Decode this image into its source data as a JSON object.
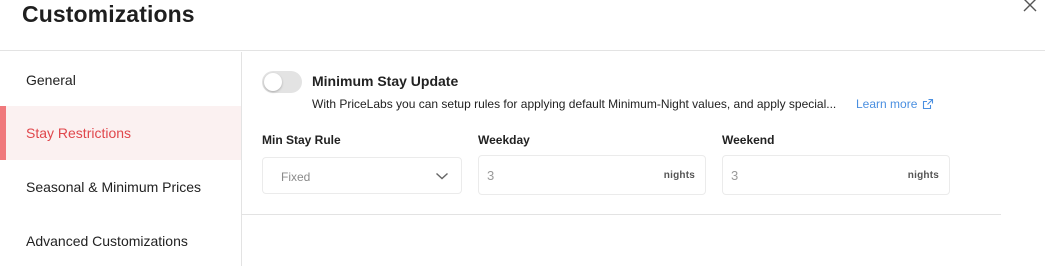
{
  "dialog": {
    "title": "Customizations",
    "close_icon": "close-icon"
  },
  "sidebar": {
    "items": [
      {
        "label": "General",
        "active": false
      },
      {
        "label": "Stay Restrictions",
        "active": true
      },
      {
        "label": "Seasonal & Minimum Prices",
        "active": false
      },
      {
        "label": "Advanced Customizations",
        "active": false
      }
    ]
  },
  "min_stay": {
    "toggle_on": false,
    "title": "Minimum Stay Update",
    "description": "With PriceLabs you can setup rules for applying default Minimum-Night values, and apply special...",
    "learn_more": "Learn more",
    "learn_more_icon": "external-link-icon"
  },
  "fields": {
    "rule_label": "Min Stay Rule",
    "rule_value": "Fixed",
    "weekday_label": "Weekday",
    "weekday_value": "3",
    "weekday_unit": "nights",
    "weekend_label": "Weekend",
    "weekend_value": "3",
    "weekend_unit": "nights"
  },
  "colors": {
    "accent": "#e0474c",
    "active_bg": "#fbf1f1",
    "active_bar": "#f0797c",
    "link": "#4a8fe0",
    "toggle_off": "#e3e3e3"
  }
}
